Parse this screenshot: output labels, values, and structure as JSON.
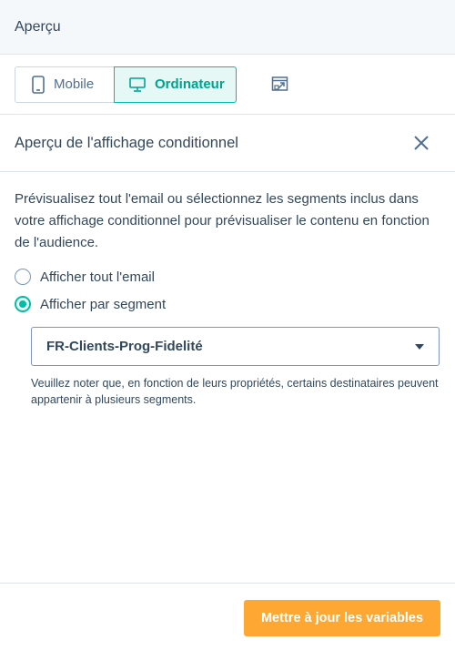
{
  "header": {
    "title": "Aperçu"
  },
  "toolbar": {
    "mobile_label": "Mobile",
    "desktop_label": "Ordinateur",
    "accent": "#00bda5"
  },
  "panel": {
    "title": "Aperçu de l'affichage conditionnel",
    "description": "Prévisualisez tout l'email ou sélectionnez les segments inclus dans votre affichage conditionnel pour prévisualiser le contenu en fonction de l'audience.",
    "options": [
      {
        "label": "Afficher tout l'email",
        "checked": false
      },
      {
        "label": "Afficher par segment",
        "checked": true
      }
    ],
    "segment_select": {
      "value": "FR-Clients-Prog-Fidelité"
    },
    "note": "Veuillez noter que, en fonction de leurs propriétés, certains destinataires peuvent appartenir à plusieurs segments."
  },
  "footer": {
    "update_button_label": "Mettre à jour les variables",
    "button_color": "#ffa733"
  }
}
